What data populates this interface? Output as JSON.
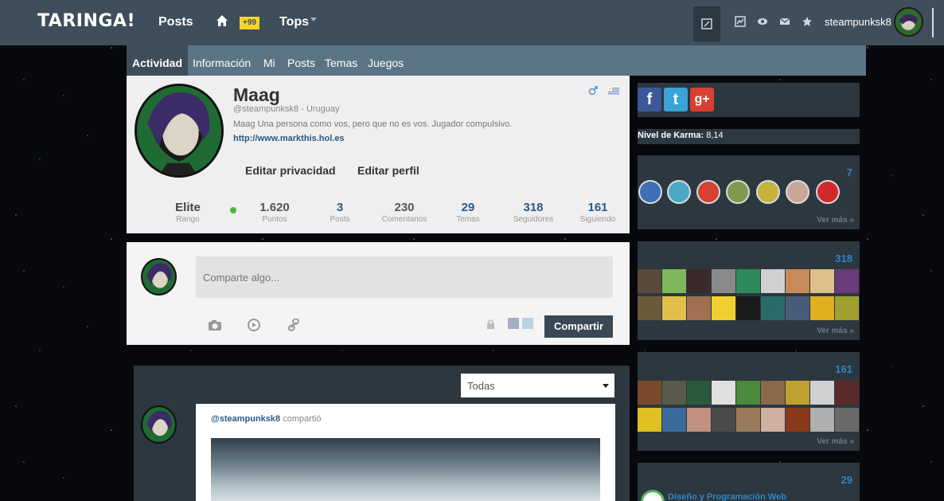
{
  "topbar": {
    "logo": "TARINGA!",
    "posts": "Posts",
    "notif_badge": "+99",
    "tops": "Tops",
    "username": "steampunksk8"
  },
  "tabs": [
    "Actividad",
    "Información",
    "Mi",
    "Posts",
    "Temas",
    "Juegos"
  ],
  "profile": {
    "name": "Maag",
    "handle": "@steampunksk8 - Uruguay",
    "bio": "Maag Una persona como vos, pero que no es vos. Jugador compulsivo.",
    "link": "http://www.markthis.hol.es",
    "edit_privacy": "Editar privacidad",
    "edit_profile": "Editar perfil",
    "stats": [
      {
        "value": "Elite",
        "label": "Rango"
      },
      {
        "value": "1.620",
        "label": "Puntos"
      },
      {
        "value": "3",
        "label": "Posts"
      },
      {
        "value": "230",
        "label": "Comentarios"
      },
      {
        "value": "29",
        "label": "Temas"
      },
      {
        "value": "318",
        "label": "Seguidores"
      },
      {
        "value": "161",
        "label": "Siguiendo"
      }
    ]
  },
  "share": {
    "placeholder": "Comparte algo...",
    "button": "Compartir"
  },
  "feed": {
    "filter": "Todas",
    "author": "@steampunksk8",
    "action": "compartió"
  },
  "sidebar": {
    "karma_label": "Nivel de Karma:",
    "karma_value": "8,14",
    "medals_count": "7",
    "followers_count": "318",
    "following_count": "161",
    "topics_count": "29",
    "ver_mas": "Ver más »",
    "category": "Diseño y Programación Web"
  },
  "colors": {
    "topbar": "#3e4e5a",
    "accent_blue": "#2f86c4",
    "badge_yellow": "#f5d52a"
  }
}
